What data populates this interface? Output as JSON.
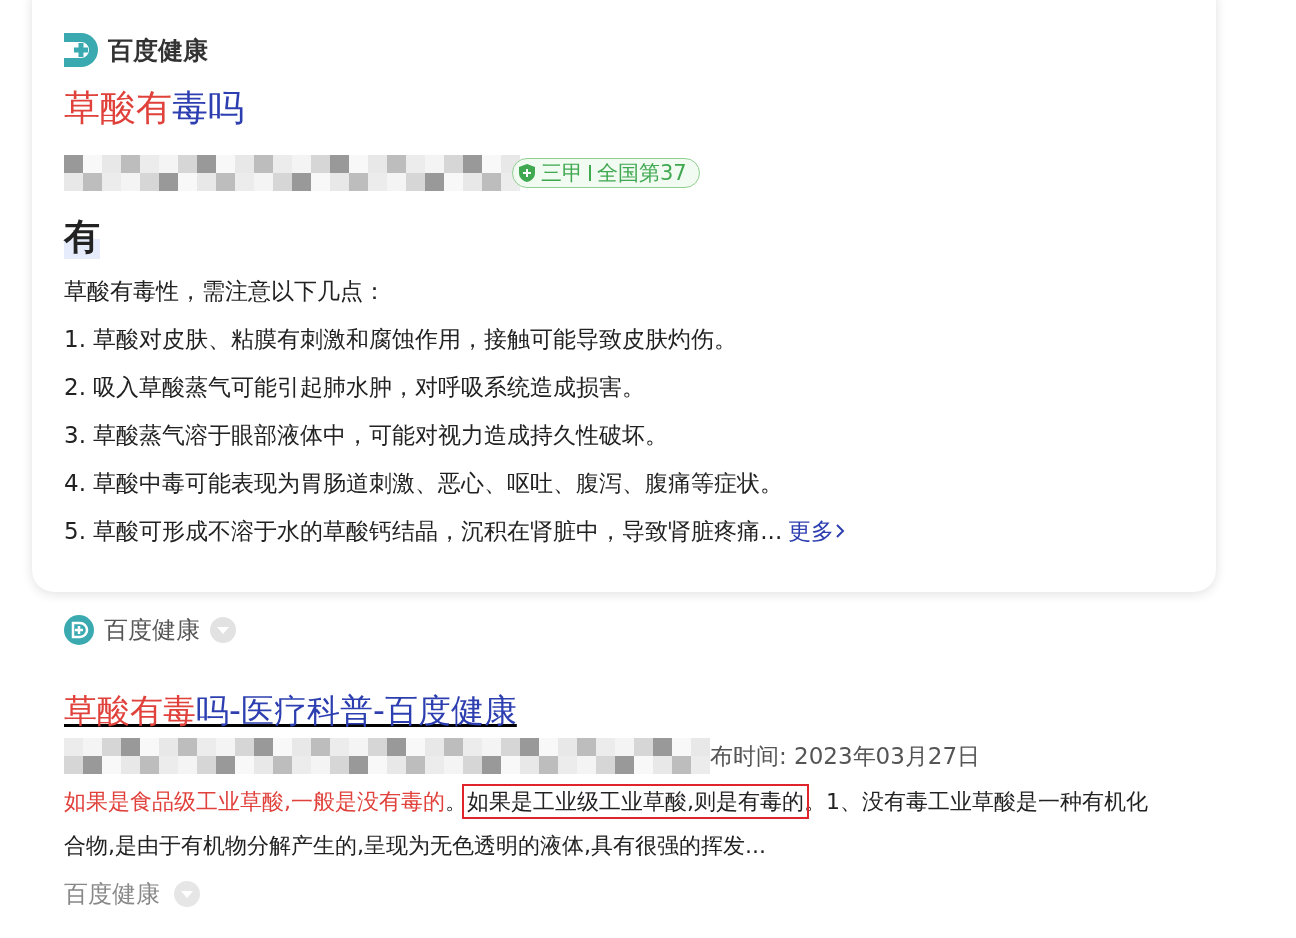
{
  "card": {
    "brand": "百度健康",
    "title": [
      {
        "text": "草酸有",
        "highlight": true
      },
      {
        "text": "毒吗",
        "highlight": false
      }
    ],
    "source_badge": {
      "grade": "三甲",
      "rank": "全国第37"
    },
    "answer": "有",
    "intro": "草酸有毒性，需注意以下几点：",
    "points": [
      "1. 草酸对皮肤、粘膜有刺激和腐蚀作用，接触可能导致皮肤灼伤。",
      "2. 吸入草酸蒸气可能引起肺水肿，对呼吸系统造成损害。",
      "3. 草酸蒸气溶于眼部液体中，可能对视力造成持久性破坏。",
      "4. 草酸中毒可能表现为胃肠道刺激、恶心、呕吐、腹泻、腹痛等症状。",
      "5. 草酸可形成不溶于水的草酸钙结晶，沉积在肾脏中，导致肾脏疼痛..."
    ],
    "more_link": "更多"
  },
  "card_source": "百度健康",
  "result": {
    "title": [
      {
        "text": "草酸有毒",
        "highlight": true
      },
      {
        "text": "吗-医疗科普-百度健康",
        "highlight": false
      }
    ],
    "date": "布时间: 2023年03月27日",
    "snippet": [
      {
        "text": "如果是食品级工业草酸,一般是没有毒的",
        "highlight": true,
        "boxed": false
      },
      {
        "text": "。",
        "highlight": false,
        "boxed": false
      },
      {
        "text": "如果是工业级工业草酸,则是有毒的",
        "highlight": false,
        "boxed": true
      },
      {
        "text": "。1、没有毒工业草酸是一种有机化合物,是由于有机物分解产生的,呈现为无色透明的液体,具有很强的挥发...",
        "highlight": false,
        "boxed": false
      }
    ],
    "source": "百度健康"
  }
}
